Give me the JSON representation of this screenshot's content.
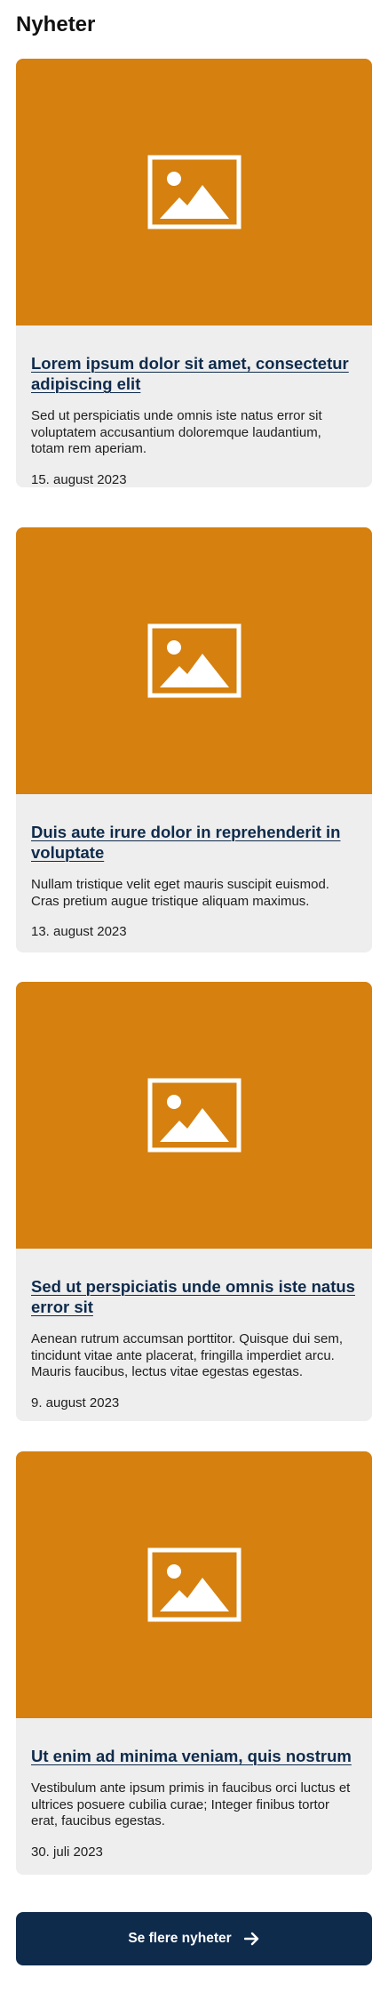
{
  "section": {
    "title": "Nyheter"
  },
  "colors": {
    "image_placeholder": "#d5800f",
    "card_background": "#eeeeee",
    "title_link": "#0f2b4c",
    "button_background": "#0f2b4c"
  },
  "news": [
    {
      "image_icon": "image-placeholder-icon",
      "title": "Lorem ipsum dolor sit amet, consectetur adipiscing elit",
      "excerpt": "Sed ut perspiciatis unde omnis iste natus error sit voluptatem accusantium doloremque laudantium, totam rem aperiam.",
      "date": "15. august 2023"
    },
    {
      "image_icon": "image-placeholder-icon",
      "title": "Duis aute irure dolor in reprehenderit in voluptate",
      "excerpt": "Nullam tristique velit eget mauris suscipit euismod. Cras pretium augue tristique aliquam maximus.",
      "date": "13. august 2023"
    },
    {
      "image_icon": "image-placeholder-icon",
      "title": "Sed ut perspiciatis unde omnis iste natus error sit",
      "excerpt": "Aenean rutrum accumsan porttitor. Quisque dui sem, tincidunt vitae ante placerat, fringilla imperdiet arcu. Mauris faucibus, lectus vitae egestas egestas.",
      "date": "9. august 2023"
    },
    {
      "image_icon": "image-placeholder-icon",
      "title": "Ut enim ad minima veniam, quis nostrum",
      "excerpt": "Vestibulum ante ipsum primis in faucibus orci luctus et ultrices posuere cubilia curae; Integer finibus tortor erat, faucibus egestas.",
      "date": "30. juli 2023"
    }
  ],
  "more_button": {
    "label": "Se flere nyheter",
    "icon": "arrow-right-icon"
  }
}
